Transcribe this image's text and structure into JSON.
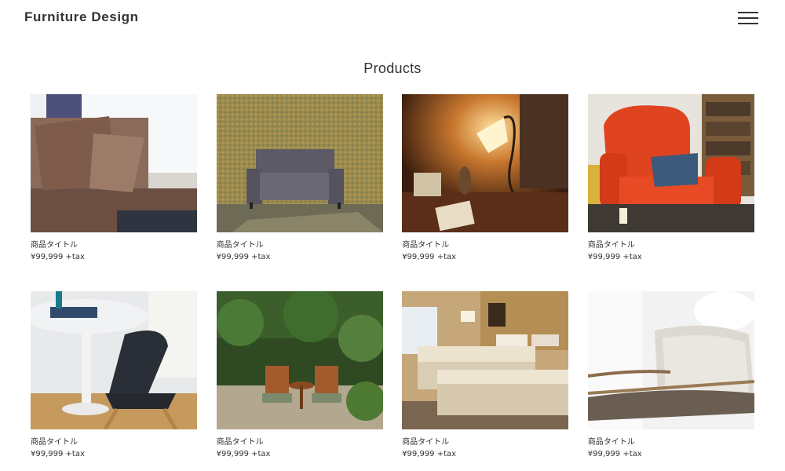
{
  "header": {
    "site_title": "Furniture Design",
    "menu_icon": "hamburger-menu-icon"
  },
  "section": {
    "title": "Products"
  },
  "products": [
    {
      "title": "商品タイトル",
      "price": "¥99,999 +tax",
      "image": "sofa-cushions"
    },
    {
      "title": "商品タイトル",
      "price": "¥99,999 +tax",
      "image": "grey-armchair"
    },
    {
      "title": "商品タイトル",
      "price": "¥99,999 +tax",
      "image": "table-lamp"
    },
    {
      "title": "商品タイトル",
      "price": "¥99,999 +tax",
      "image": "red-wingback-chair"
    },
    {
      "title": "商品タイトル",
      "price": "¥99,999 +tax",
      "image": "dining-table-chair"
    },
    {
      "title": "商品タイトル",
      "price": "¥99,999 +tax",
      "image": "garden-chairs"
    },
    {
      "title": "商品タイトル",
      "price": "¥99,999 +tax",
      "image": "hotel-beds"
    },
    {
      "title": "商品タイトル",
      "price": "¥99,999 +tax",
      "image": "lounge-chair"
    }
  ]
}
